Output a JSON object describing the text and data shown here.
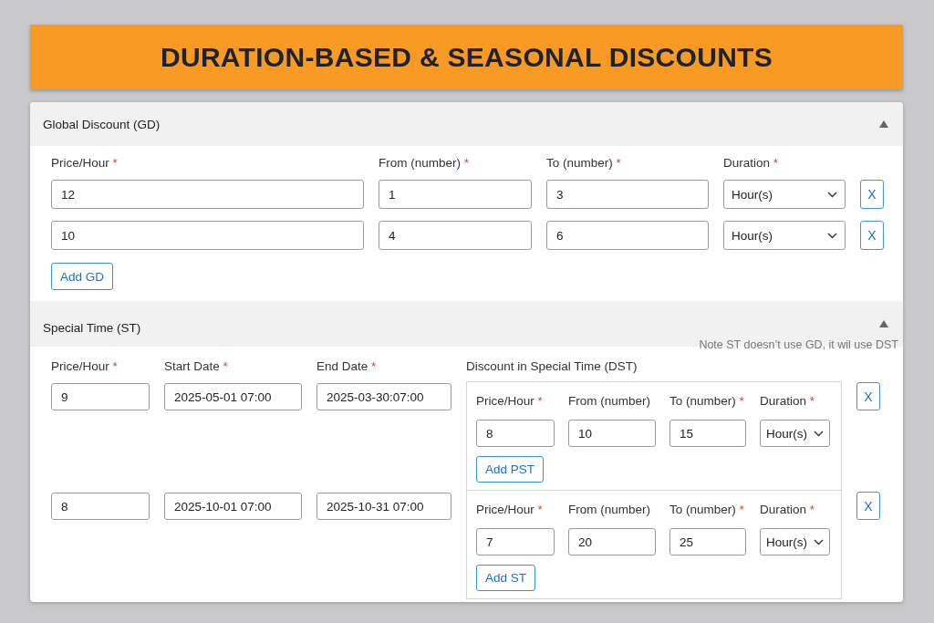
{
  "banner": {
    "title": "DURATION-BASED & SEASONAL DISCOUNTS"
  },
  "global_discount": {
    "title": "Global Discount (GD)",
    "expanded": true,
    "columns": [
      {
        "label": "Price/Hour",
        "mark": "*"
      },
      {
        "label": "From (number)",
        "mark": "*"
      },
      {
        "label": "To (number)",
        "mark": "*"
      },
      {
        "label": "Duration",
        "mark": "*"
      }
    ],
    "rows": [
      {
        "price": "12",
        "from": "1",
        "to": "3",
        "duration": "Hour(s)",
        "remove": "X"
      },
      {
        "price": "10",
        "from": "4",
        "to": "6",
        "duration": "Hour(s)",
        "remove": "X"
      }
    ],
    "add_button": "Add GD"
  },
  "special_time": {
    "title": "Special Time (ST)",
    "expanded": true,
    "note": "Note ST doesn’t use GD, it wil use DST",
    "columns": [
      {
        "label": "Price/Hour",
        "mark": "*"
      },
      {
        "label": "Start Date",
        "mark": "*"
      },
      {
        "label": "End Date",
        "mark": "*"
      },
      {
        "label": "Discount in Special Time (DST)"
      }
    ],
    "rows": [
      {
        "price": "9",
        "start_date": "2025-05-01 07:00",
        "end_date": "2025-03-30:07:00",
        "dst": {
          "columns": [
            {
              "label": "Price/Hour",
              "mark": "*"
            },
            {
              "label": "From (number)"
            },
            {
              "label": "To (number)",
              "mark": "*"
            },
            {
              "label": "Duration",
              "mark": "*"
            }
          ],
          "price": "8",
          "from": "10",
          "to": "15",
          "duration": "Hour(s)",
          "add_button": "Add PST"
        },
        "remove": "X"
      },
      {
        "price": "8",
        "start_date": "2025-10-01 07:00",
        "end_date": "2025-10-31 07:00",
        "dst": {
          "columns": [
            {
              "label": "Price/Hour",
              "mark": "*"
            },
            {
              "label": "From (number)"
            },
            {
              "label": "To (number)",
              "mark": "*"
            },
            {
              "label": "Duration",
              "mark": "*"
            }
          ],
          "price": "7",
          "from": "20",
          "to": "25",
          "duration": "Hour(s)",
          "add_button": "Add ST"
        },
        "remove": "X"
      }
    ]
  }
}
